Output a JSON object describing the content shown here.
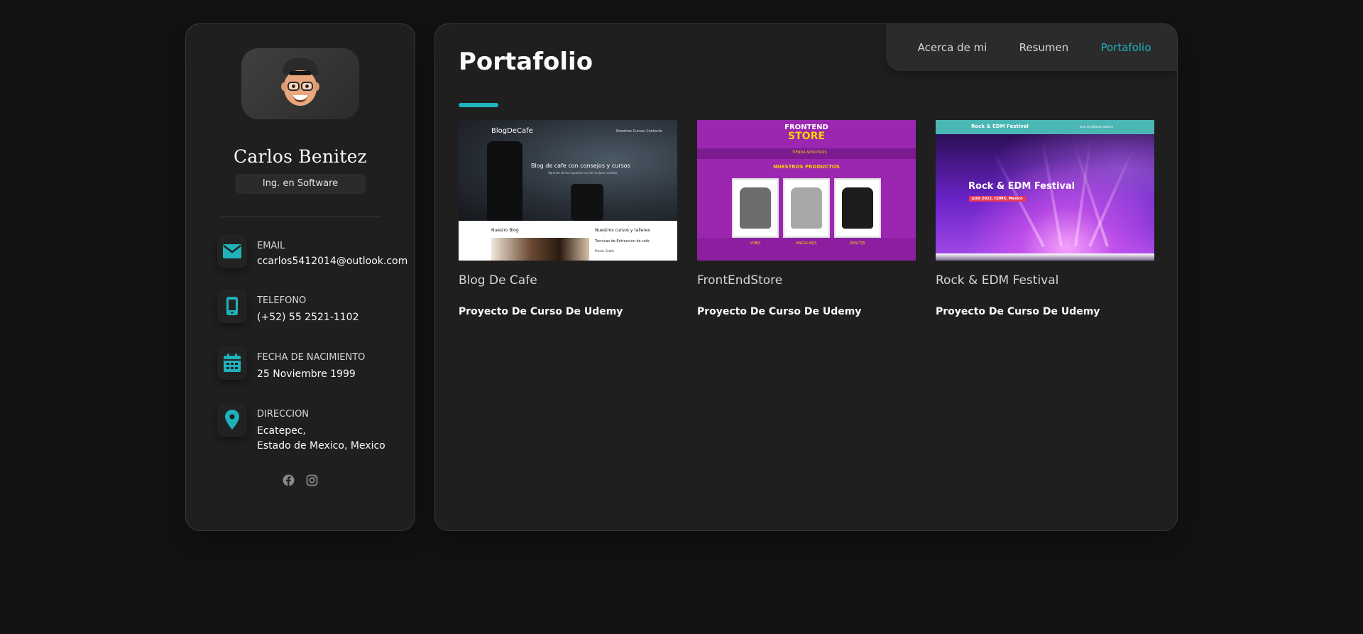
{
  "profile": {
    "name": "Carlos Benitez",
    "title": "Ing. en Software",
    "avatar_icon": "memoji-avatar"
  },
  "contacts": [
    {
      "icon": "envelope-icon",
      "label": "EMAIL",
      "value": "ccarlos5412014@outlook.com"
    },
    {
      "icon": "phone-icon",
      "label": "TELEFONO",
      "value": "(+52) 55 2521-1102"
    },
    {
      "icon": "calendar-icon",
      "label": "FECHA DE NACIMIENTO",
      "value": "25 Noviembre 1999"
    },
    {
      "icon": "map-pin-icon",
      "label": "DIRECCION",
      "value_line1": "Ecatepec,",
      "value_line2": "Estado de Mexico, Mexico"
    }
  ],
  "socials": [
    "facebook-icon",
    "instagram-icon"
  ],
  "navbar": {
    "links": [
      {
        "label": "Acerca de mi",
        "active": false
      },
      {
        "label": "Resumen",
        "active": false
      },
      {
        "label": "Portafolio",
        "active": true
      }
    ]
  },
  "page": {
    "title": "Portafolio"
  },
  "projects": [
    {
      "title": "Blog De Cafe",
      "subtitle": "Proyecto De Curso De Udemy",
      "thumb": {
        "logo": "BlogDeCafe",
        "menu": "Nosotros  Cursos  Contacto",
        "hero_text": "Blog de cafe con consejos y cursos",
        "hero_sub": "Aprende de los expertos con las mejores recetas",
        "section_left": "Nuestro Blog",
        "section_right": "Nuestros cursos y talleres",
        "section_right_item": "Tecnicas de Extraccion de cafe",
        "section_right_meta": "Precio: Gratis"
      }
    },
    {
      "title": "FrontEndStore",
      "subtitle": "Proyecto De Curso De Udemy",
      "thumb": {
        "brand_line1": "FRONTEND",
        "brand_line2": "STORE",
        "nav": "TIENDA  NOSOTROS",
        "heading": "NUESTROS PRODUCTOS",
        "products": [
          "VUEJS",
          "ANGULARJS",
          "REACTJS"
        ]
      }
    },
    {
      "title": "Rock & EDM Festival",
      "subtitle": "Proyecto De Curso De Udemy",
      "thumb": {
        "header_title": "Rock & EDM Festival",
        "header_links": "Line Up   Boletos   Galeria",
        "hero_title": "Rock & EDM Festival",
        "hero_badge": "Julio 2022, CDMX, Mexico"
      }
    }
  ],
  "colors": {
    "accent": "#20b2bb",
    "background": "#121212",
    "card": "#1f1f1f",
    "nav_bg": "#2b2b2c"
  }
}
